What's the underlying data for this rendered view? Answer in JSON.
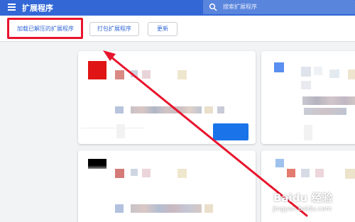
{
  "header": {
    "title": "扩展程序",
    "menu_icon": "hamburger-menu-icon",
    "search_placeholder": "搜索扩展程序",
    "search_icon": "search-icon",
    "bg_color": "#3367d6"
  },
  "toolbar": {
    "load_unpacked_label": "加载已解压的扩展程序",
    "pack_label": "打包扩展程序",
    "update_label": "更新"
  },
  "annotation": {
    "highlight_color": "#e8142d"
  },
  "watermark": {
    "brand": "Baidu 经验",
    "url": "jingyan.baidu.com"
  }
}
